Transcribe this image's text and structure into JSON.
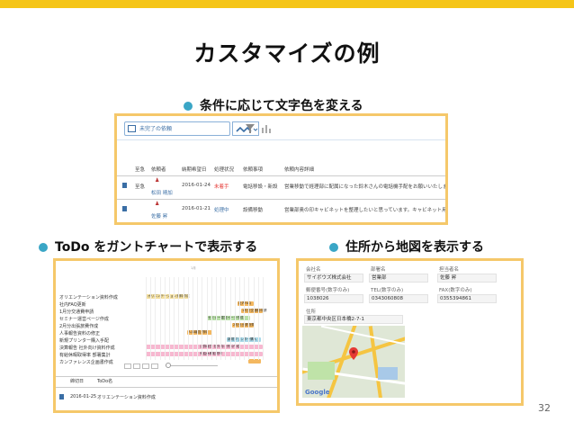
{
  "colors": {
    "accent": "#f5c518",
    "frame": "#f5c86a",
    "bullet": "#3aa6c6"
  },
  "slide": {
    "title": "カスタマイズの例",
    "page_number": "32"
  },
  "section1": {
    "heading": "条件に応じて文字色を変える",
    "view_selector": "未完了の依頼",
    "columns": [
      "至急",
      "依頼者",
      "納期希望日",
      "処理状況",
      "依頼事項",
      "依頼内容詳細"
    ],
    "rows": [
      {
        "urgent": "至急",
        "requester": "松田 晴加",
        "due": "2016-01-24",
        "status": "未着手",
        "status_color": "red",
        "item": "電話移設・新設",
        "detail": "営業移動で経理部に配属になった鈴木さんの電話機手配をお願いいたします。"
      },
      {
        "urgent": "",
        "requester": "佐藤 昇",
        "due": "2016-01-21",
        "status": "処理中",
        "status_color": "blue",
        "item": "設備移動",
        "detail": "営業部奥の印キャビネットを整理したいと思っています。キャビネット用の値"
      }
    ]
  },
  "section2": {
    "heading": "ToDo をガントチャートで表示する",
    "month_label": "1月",
    "tasks": [
      "オリエンテーション資料作成",
      "社内FAQ更新",
      "1月分交通費申請",
      "セミナー運営ページ作成",
      "2月分出張旅費作成",
      "人事報告資料の修正",
      "新規プリンター購入手配",
      "決算報告 社外向け資料作成",
      "有給休暇取得率 部署集計",
      "カンファレンス企画書作成"
    ],
    "bars": [
      {
        "label": "オリエンテーション資料作成",
        "color": "#f4e0a0"
      },
      {
        "label": "社内FAQ",
        "color": "#f4b860"
      },
      {
        "label": "1月分交通費申請",
        "color": "#f4b860"
      },
      {
        "label": "セミナー運営ページ作成",
        "color": "#b9e0a8"
      },
      {
        "label": "2月分出張旅費",
        "color": "#f4b860"
      },
      {
        "label": "人事報告資料",
        "color": "#f4b860"
      },
      {
        "label": "新規プリンター購入",
        "color": "#a8d8e8"
      },
      {
        "label": "決算報告 社外向け資料作成",
        "color": "#f7b8d0"
      },
      {
        "label": "有給休暇取得率",
        "color": "#f7b8d0"
      },
      {
        "label": "",
        "color": "#f4b860"
      }
    ],
    "list_headers": [
      "締切日",
      "ToDo名"
    ],
    "list_row": {
      "date": "2016-01-25",
      "name": "オリエンテーション資料作成"
    }
  },
  "section3": {
    "heading": "住所から地図を表示する",
    "fields": [
      {
        "label": "会社名",
        "value": "サイボウズ株式会社"
      },
      {
        "label": "部署名",
        "value": "営業部"
      },
      {
        "label": "担当者名",
        "value": "佐藤 昇"
      },
      {
        "label": "郵便番号(数字のみ)",
        "value": "1038026"
      },
      {
        "label": "TEL(数字のみ)",
        "value": "0343060808"
      },
      {
        "label": "FAX(数字のみ)",
        "value": "0355394861"
      }
    ],
    "address_label": "住所",
    "address_value": "東京都中央区日本橋2-7-1",
    "map_logo": "Google"
  }
}
